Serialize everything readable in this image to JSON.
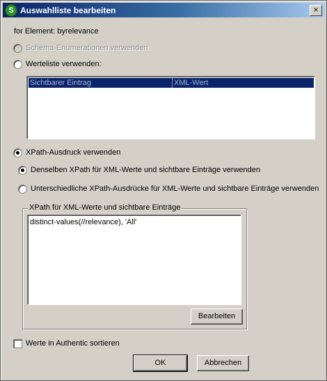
{
  "window": {
    "title": "Auswahlliste bearbeiten",
    "close_glyph": "×",
    "app_icon_letter": "S"
  },
  "element_label": "for Element: byrelevance",
  "options": {
    "schema_enum": "Schema-Enumerationen verwenden",
    "value_list": "Werteliste verwenden:",
    "xpath_expr": "XPath-Ausdruck verwenden",
    "same_xpath": "Denselben XPath für XML-Werte und sichtbare Einträge verwenden",
    "different_xpath": "Unterschiedliche XPath-Ausdrücke für XML-Werte und sichtbare Einträge verwenden"
  },
  "value_table": {
    "columns": [
      "Sichtbarer Eintrag",
      "XML-Wert"
    ]
  },
  "xpath_group": {
    "legend": "XPath für XML-Werte und sichtbare Einträge",
    "expression": "distinct-values(//relevance), 'All'",
    "edit_button": "Bearbeiten"
  },
  "sort_checkbox": "Werte in Authentic sortieren",
  "buttons": {
    "ok": "OK",
    "cancel": "Abbrechen"
  }
}
